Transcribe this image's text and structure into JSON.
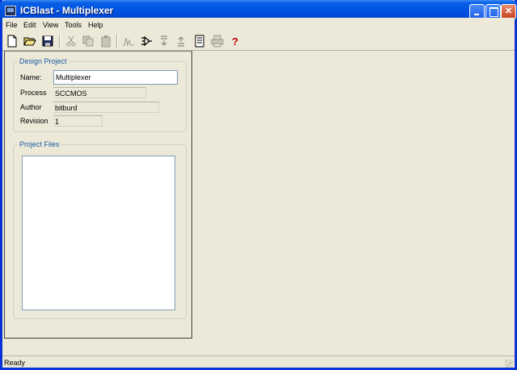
{
  "window": {
    "title": "ICBlast - Multiplexer"
  },
  "menu": {
    "items": [
      "File",
      "Edit",
      "View",
      "Tools",
      "Help"
    ]
  },
  "toolbar": {
    "buttons": [
      "new-file-icon",
      "open-folder-icon",
      "save-icon",
      "cut-icon",
      "copy-icon",
      "paste-icon",
      "waveform-icon",
      "schematic-icon",
      "import-icon",
      "export-icon",
      "document-icon",
      "print-icon",
      "help-icon"
    ]
  },
  "design_project": {
    "title": "Design Project",
    "name_label": "Name:",
    "name_value": "Multiplexer",
    "process_label": "Process",
    "process_value": "SCCMOS",
    "author_label": "Author",
    "author_value": "bitburd",
    "revision_label": "Revision",
    "revision_value": "1"
  },
  "project_files": {
    "title": "Project Files",
    "files": []
  },
  "status": {
    "text": "Ready"
  }
}
